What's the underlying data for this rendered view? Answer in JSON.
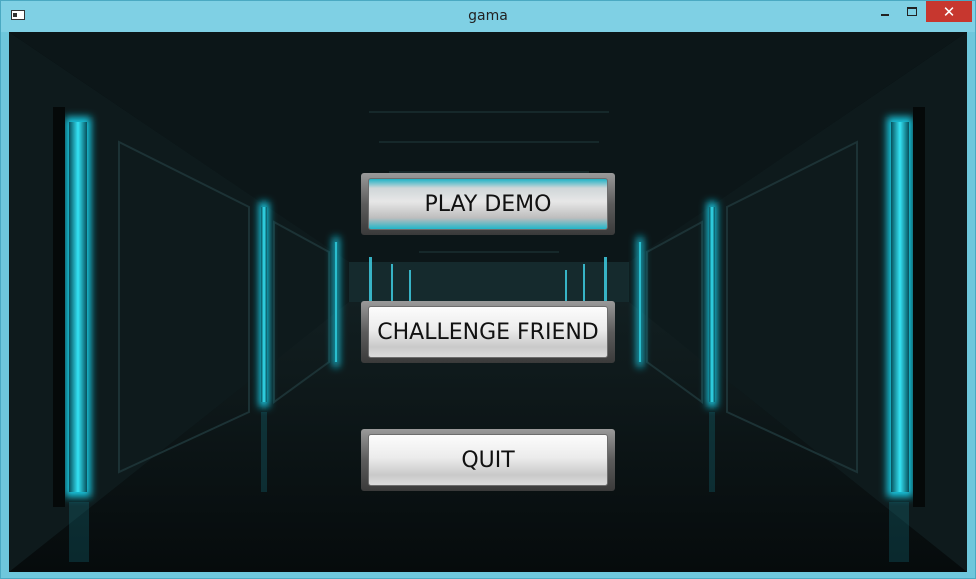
{
  "window": {
    "title": "gama",
    "close_glyph": "✕"
  },
  "menu": {
    "play_demo": "PLAY DEMO",
    "challenge_friend": "CHALLENGE FRIEND",
    "quit": "QUIT"
  },
  "colors": {
    "titlebar": "#7fd0e4",
    "close": "#c7372f",
    "accent": "#1fb3c6",
    "background": "#0a1416"
  },
  "icons": [
    "app-icon",
    "minimize-icon",
    "maximize-icon",
    "close-icon"
  ]
}
